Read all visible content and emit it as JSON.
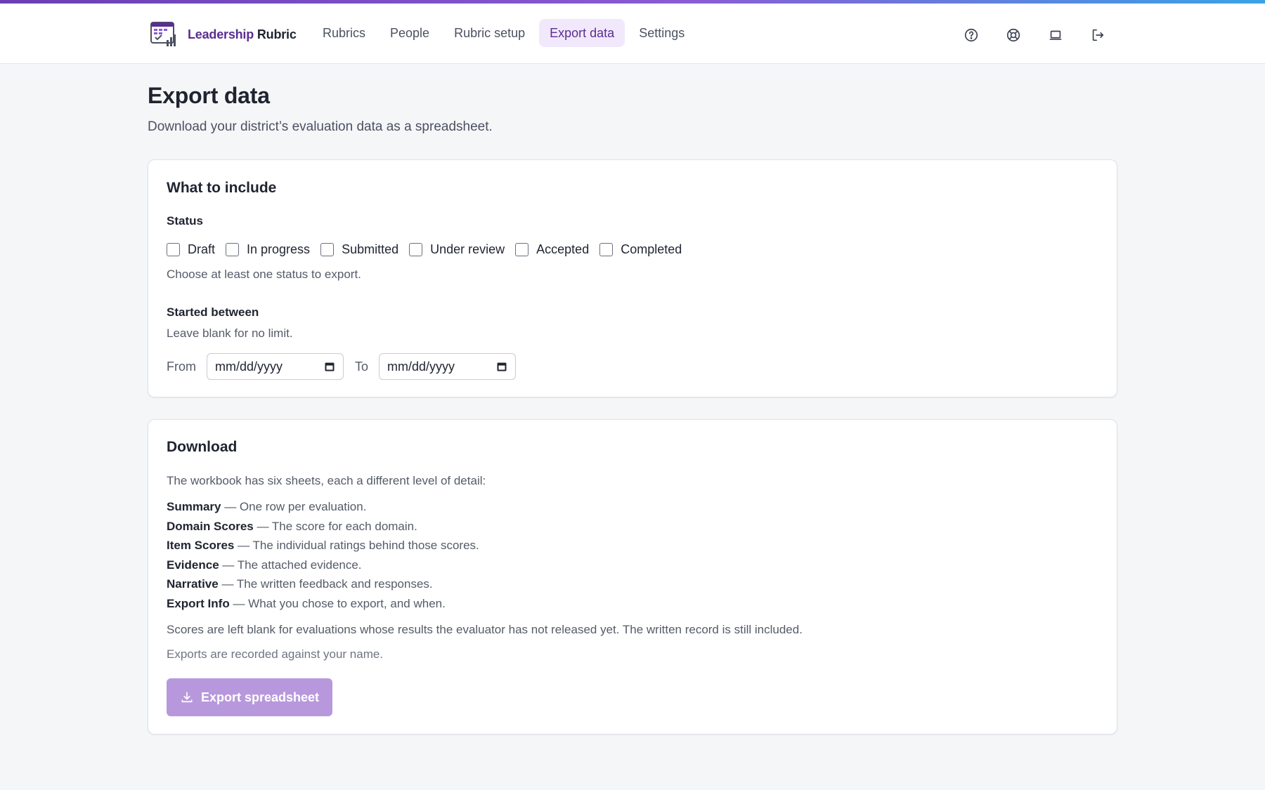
{
  "brand": {
    "name_part1": "Leadership",
    "name_part2": "Rubric"
  },
  "nav": {
    "links": [
      "Rubrics",
      "People",
      "Rubric setup",
      "Export data",
      "Settings"
    ],
    "active": "Export data",
    "icons": [
      "help-circle-icon",
      "lifebuoy-icon",
      "laptop-icon",
      "logout-icon"
    ]
  },
  "page": {
    "title": "Export data",
    "subtitle": "Download your district’s evaluation data as a spreadsheet."
  },
  "include": {
    "title": "What to include",
    "status_label": "Status",
    "statuses": [
      "Draft",
      "In progress",
      "Submitted",
      "Under review",
      "Accepted",
      "Completed"
    ],
    "status_hint": "Choose at least one status to export.",
    "started_label": "Started between",
    "started_hint": "Leave blank for no limit.",
    "from_label": "From",
    "to_label": "To",
    "from_placeholder": "mm/dd/yyyy",
    "to_placeholder": "mm/dd/yyyy"
  },
  "download": {
    "title": "Download",
    "intro": "The workbook has six sheets, each a different level of detail:",
    "sheets": [
      {
        "name": "Summary",
        "desc": " — One row per evaluation."
      },
      {
        "name": "Domain Scores",
        "desc": " — The score for each domain."
      },
      {
        "name": "Item Scores",
        "desc": " — The individual ratings behind those scores."
      },
      {
        "name": "Evidence",
        "desc": " — The attached evidence."
      },
      {
        "name": "Narrative",
        "desc": " — The written feedback and responses."
      },
      {
        "name": "Export Info",
        "desc": " — What you chose to export, and when."
      }
    ],
    "note": "Scores are left blank for evaluations whose results the evaluator has not released yet. The written record is still included.",
    "recorded": "Exports are recorded against your name.",
    "button_label": "Export spreadsheet"
  },
  "colors": {
    "accent": "#5b2d91",
    "active_tab_bg": "#f1e9fb",
    "button_disabled": "#b898dc",
    "page_bg": "#f5f6f8"
  }
}
